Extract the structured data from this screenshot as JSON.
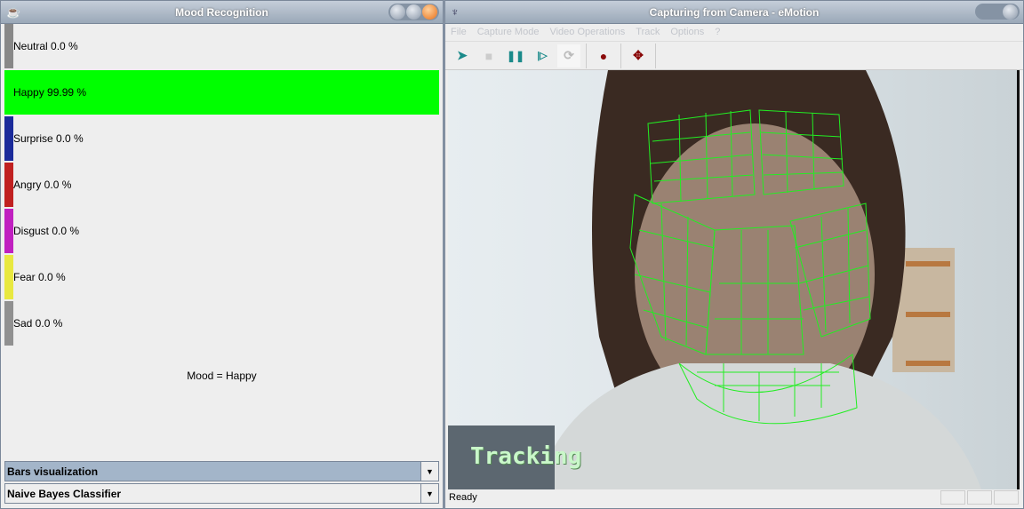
{
  "mood_window": {
    "title": "Mood Recognition",
    "rows": [
      {
        "label": "Neutral 0.0 %",
        "value": 0.0,
        "color": "#888888"
      },
      {
        "label": "Happy 99.99 %",
        "value": 99.99,
        "color": "#00ff00"
      },
      {
        "label": "Surprise 0.0 %",
        "value": 0.0,
        "color": "#1a2a9a"
      },
      {
        "label": "Angry 0.0 %",
        "value": 0.0,
        "color": "#c02020"
      },
      {
        "label": "Disgust 0.0 %",
        "value": 0.0,
        "color": "#c020c0"
      },
      {
        "label": "Fear 0.0 %",
        "value": 0.0,
        "color": "#e8e840"
      },
      {
        "label": "Sad 0.0 %",
        "value": 0.0,
        "color": "#909090"
      }
    ],
    "mood_result": "Mood = Happy",
    "visualization_select": "Bars visualization",
    "classifier_select": "Naive Bayes Classifier"
  },
  "camera_window": {
    "title": "Capturing from Camera - eMotion",
    "menu": [
      "File",
      "Capture Mode",
      "Video Operations",
      "Track",
      "Options",
      "?"
    ],
    "toolbar": [
      "play-icon",
      "stop-icon",
      "pause-icon",
      "step-icon",
      "refresh-icon",
      "record-icon",
      "move-icon"
    ],
    "overlay_text": "Tracking",
    "status": "Ready"
  }
}
